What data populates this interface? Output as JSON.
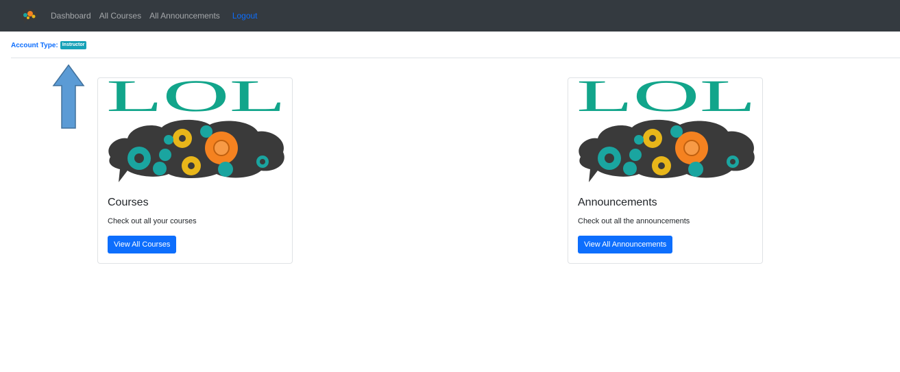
{
  "navbar": {
    "brand_icon": "brain-gears-logo-icon",
    "links": [
      "Dashboard",
      "All Courses",
      "All Announcements"
    ],
    "logout": "Logout",
    "bg_color": "#343a40",
    "link_color": "#0d6efd"
  },
  "account": {
    "label": "Account Type:",
    "type": "Instructor",
    "badge_color": "#17a2b8"
  },
  "annotation_icon": "blue-up-arrow-icon",
  "cards": [
    {
      "logo_text": "LOL",
      "title": "Courses",
      "text": "Check out all your courses",
      "button": "View All Courses"
    },
    {
      "logo_text": "LOL",
      "title": "Announcements",
      "text": "Check out all the announcements",
      "button": "View All Announcements"
    }
  ],
  "colors": {
    "logo_teal": "#12a58b",
    "button_blue": "#0d6efd",
    "gear_orange": "#f58220",
    "gear_yellow": "#e8b61a",
    "gear_teal": "#1aa5a0",
    "cloud_dark": "#3a3a3a"
  }
}
